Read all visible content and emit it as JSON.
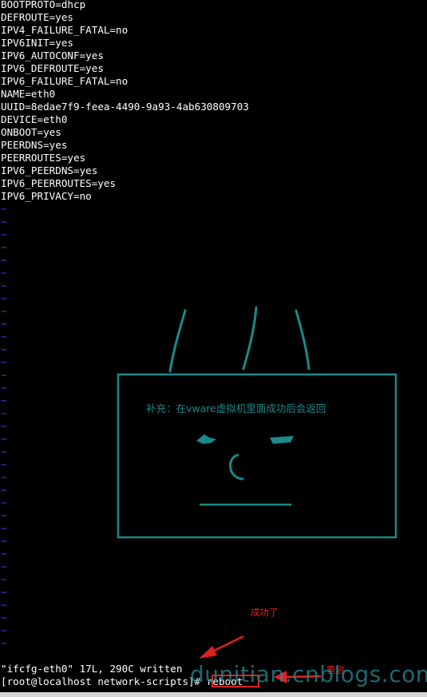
{
  "terminal": {
    "config_lines": [
      "BOOTPROTO=dhcp",
      "DEFROUTE=yes",
      "IPV4_FAILURE_FATAL=no",
      "IPV6INIT=yes",
      "IPV6_AUTOCONF=yes",
      "IPV6_DEFROUTE=yes",
      "IPV6_FAILURE_FATAL=no",
      "NAME=eth0",
      "UUID=8edae7f9-feea-4490-9a93-4ab630809703",
      "DEVICE=eth0",
      "ONBOOT=yes",
      "PEERDNS=yes",
      "PEERROUTES=yes",
      "IPV6_PEERDNS=yes",
      "IPV6_PEERROUTES=yes",
      "IPV6_PRIVACY=no"
    ],
    "tilde_char": "~",
    "written_message": "\"ifcfg-eth0\" 17L, 290C written",
    "prompt": "[root@localhost network-scripts]# ",
    "command": "reboot"
  },
  "annotations": {
    "note": "补充：在vware虚拟机里面成功后会返回",
    "success_label": "成功了",
    "reboot_label": "重启",
    "watermark": "dunitian.cnblogs.com",
    "drawing_color": "#1a8a8a",
    "arrow_color": "#e02020",
    "tilde_color": "#3a3aff"
  }
}
